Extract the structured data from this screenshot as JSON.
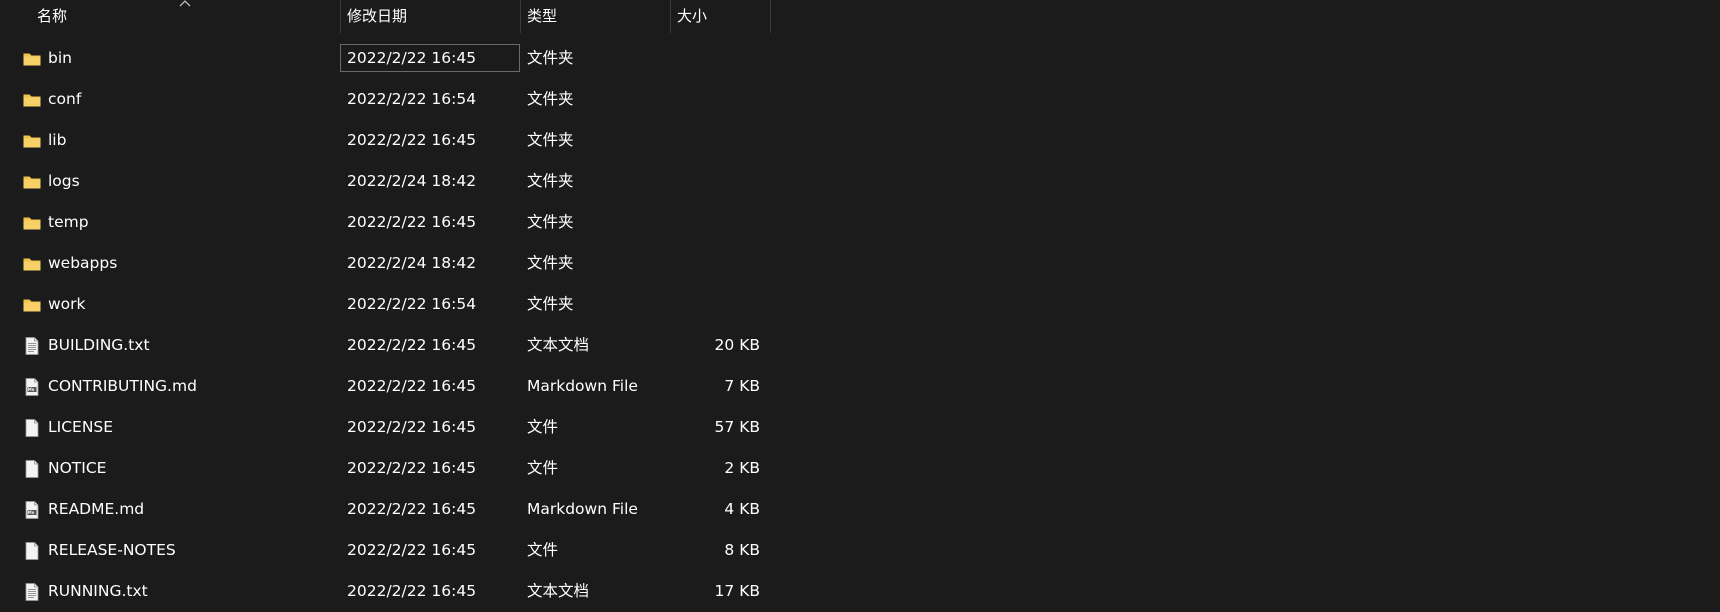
{
  "header": {
    "name_label": "名称",
    "date_label": "修改日期",
    "type_label": "类型",
    "size_label": "大小"
  },
  "colors": {
    "background": "#1b1b1b",
    "text": "#ffffff",
    "folder": "#f0c24a",
    "file": "#e8e8e8"
  },
  "files": [
    {
      "name": "bin",
      "date": "2022/2/22 16:45",
      "type": "文件夹",
      "size": "",
      "icon": "folder-icon"
    },
    {
      "name": "conf",
      "date": "2022/2/22 16:54",
      "type": "文件夹",
      "size": "",
      "icon": "folder-icon"
    },
    {
      "name": "lib",
      "date": "2022/2/22 16:45",
      "type": "文件夹",
      "size": "",
      "icon": "folder-icon"
    },
    {
      "name": "logs",
      "date": "2022/2/24 18:42",
      "type": "文件夹",
      "size": "",
      "icon": "folder-icon"
    },
    {
      "name": "temp",
      "date": "2022/2/22 16:45",
      "type": "文件夹",
      "size": "",
      "icon": "folder-icon"
    },
    {
      "name": "webapps",
      "date": "2022/2/24 18:42",
      "type": "文件夹",
      "size": "",
      "icon": "folder-icon"
    },
    {
      "name": "work",
      "date": "2022/2/22 16:54",
      "type": "文件夹",
      "size": "",
      "icon": "folder-icon"
    },
    {
      "name": "BUILDING.txt",
      "date": "2022/2/22 16:45",
      "type": "文本文档",
      "size": "20 KB",
      "icon": "text-file-icon"
    },
    {
      "name": "CONTRIBUTING.md",
      "date": "2022/2/22 16:45",
      "type": "Markdown File",
      "size": "7 KB",
      "icon": "markdown-file-icon"
    },
    {
      "name": "LICENSE",
      "date": "2022/2/22 16:45",
      "type": "文件",
      "size": "57 KB",
      "icon": "file-icon"
    },
    {
      "name": "NOTICE",
      "date": "2022/2/22 16:45",
      "type": "文件",
      "size": "2 KB",
      "icon": "file-icon"
    },
    {
      "name": "README.md",
      "date": "2022/2/22 16:45",
      "type": "Markdown File",
      "size": "4 KB",
      "icon": "markdown-file-icon"
    },
    {
      "name": "RELEASE-NOTES",
      "date": "2022/2/22 16:45",
      "type": "文件",
      "size": "8 KB",
      "icon": "file-icon"
    },
    {
      "name": "RUNNING.txt",
      "date": "2022/2/22 16:45",
      "type": "文本文档",
      "size": "17 KB",
      "icon": "text-file-icon"
    }
  ]
}
